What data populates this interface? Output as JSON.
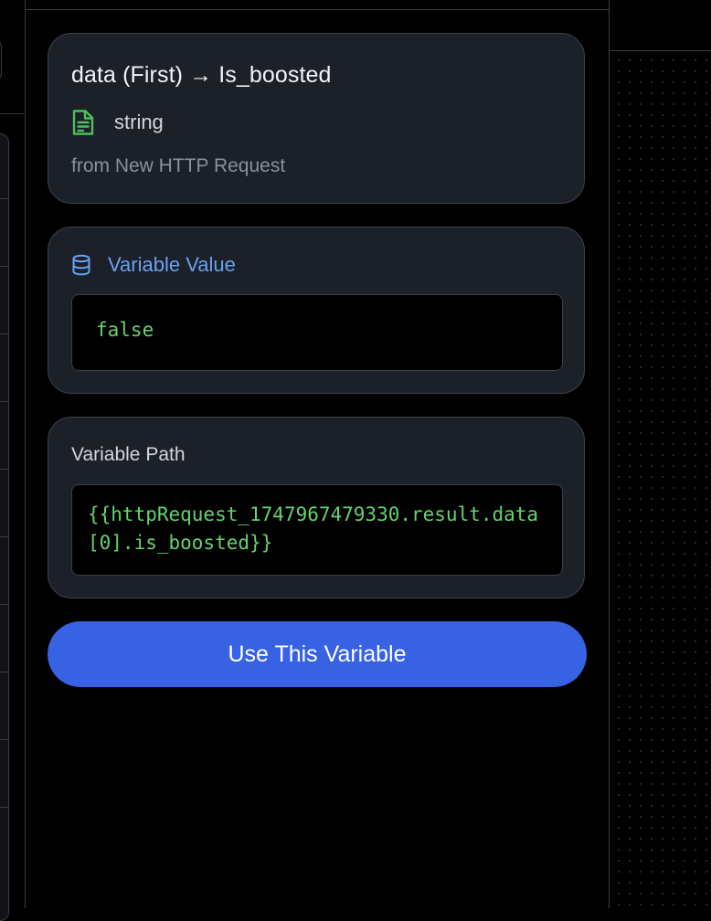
{
  "variable": {
    "title": "data (First) → Is_boosted",
    "type": "string",
    "source": "from New HTTP Request"
  },
  "value_section": {
    "label": "Variable Value",
    "value": "false"
  },
  "path_section": {
    "label": "Variable Path",
    "path": "{{httpRequest_1747967479330.result.data[0].is_boosted}}"
  },
  "actions": {
    "use_label": "Use This Variable"
  },
  "icons": {
    "type": "document-icon",
    "value": "database-icon"
  },
  "colors": {
    "accent": "#3662e3",
    "code_text": "#65d36e",
    "value_label": "#6aa2f0",
    "card_bg": "#1b2029",
    "page_bg": "#000000"
  }
}
